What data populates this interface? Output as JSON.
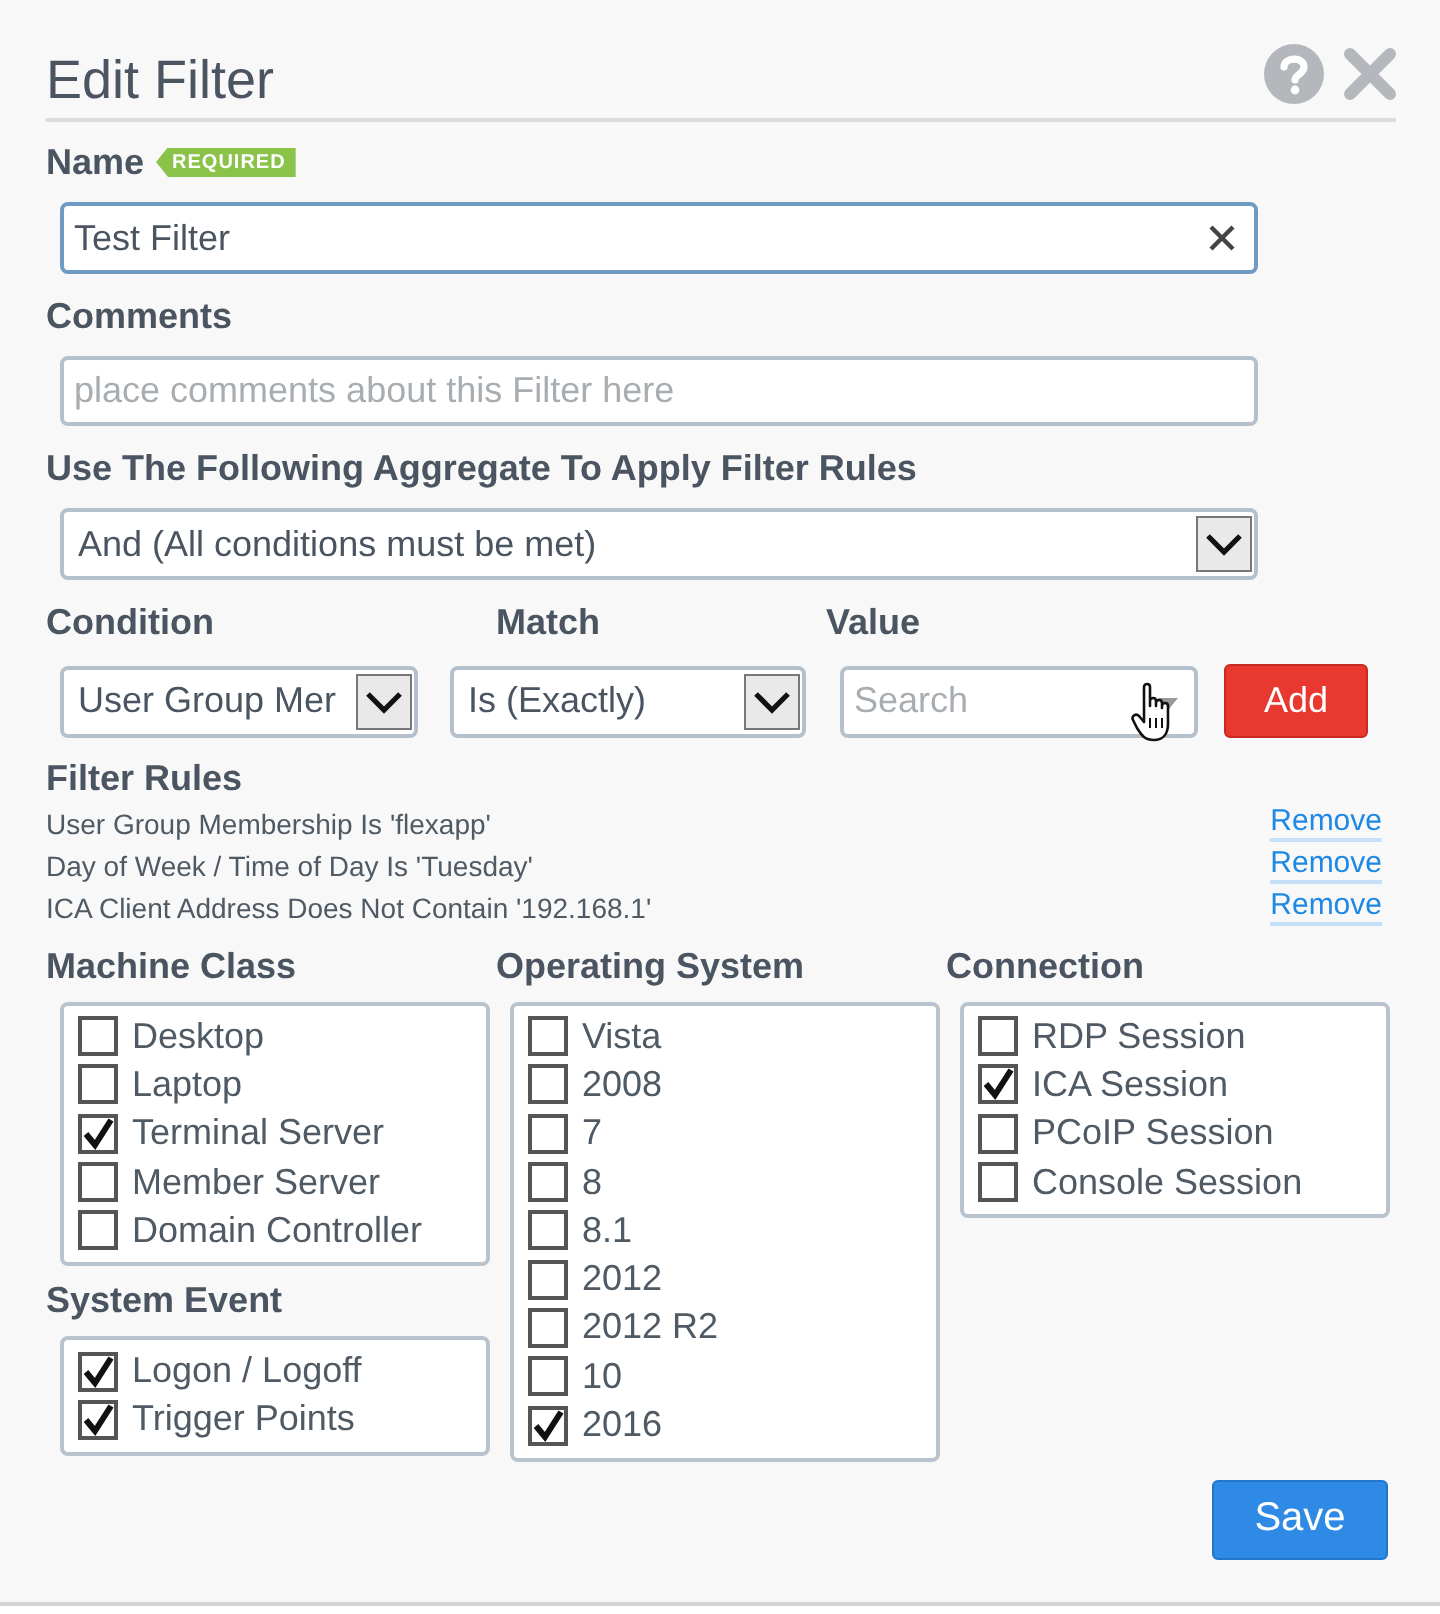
{
  "dialog": {
    "title": "Edit Filter"
  },
  "name": {
    "label": "Name",
    "badge": "REQUIRED",
    "value": "Test Filter"
  },
  "comments": {
    "label": "Comments",
    "placeholder": "place comments about this Filter here"
  },
  "aggregate": {
    "label": "Use The Following Aggregate To Apply Filter Rules",
    "value": "And (All conditions must be met)"
  },
  "condition_row": [
    {
      "label": "Condition",
      "kind": "select",
      "value": "User Group Mer"
    },
    {
      "label": "Match",
      "kind": "select",
      "value": "Is (Exactly)"
    },
    {
      "label": "Value",
      "kind": "search",
      "placeholder": "Search"
    }
  ],
  "add_button": "Add",
  "filter_rules": {
    "label": "Filter Rules",
    "rules": [
      {
        "text": "User Group Membership Is 'flexapp'",
        "action": "Remove"
      },
      {
        "text": "Day of Week / Time of Day Is 'Tuesday'",
        "action": "Remove"
      },
      {
        "text": "ICA Client Address Does Not Contain '192.168.1'",
        "action": "Remove"
      }
    ]
  },
  "columns": [
    {
      "groups": [
        {
          "label": "Machine Class",
          "options": [
            {
              "label": "Desktop",
              "checked": false
            },
            {
              "label": "Laptop",
              "checked": false
            },
            {
              "label": "Terminal Server",
              "checked": true
            },
            {
              "label": "Member Server",
              "checked": false
            },
            {
              "label": "Domain Controller",
              "checked": false
            }
          ]
        },
        {
          "label": "System Event",
          "options": [
            {
              "label": "Logon / Logoff",
              "checked": true
            },
            {
              "label": "Trigger Points",
              "checked": true
            }
          ]
        }
      ]
    },
    {
      "groups": [
        {
          "label": "Operating System",
          "options": [
            {
              "label": "Vista",
              "checked": false
            },
            {
              "label": "2008",
              "checked": false
            },
            {
              "label": "7",
              "checked": false
            },
            {
              "label": "8",
              "checked": false
            },
            {
              "label": "8.1",
              "checked": false
            },
            {
              "label": "2012",
              "checked": false
            },
            {
              "label": "2012 R2",
              "checked": false
            },
            {
              "label": "10",
              "checked": false
            },
            {
              "label": "2016",
              "checked": true
            }
          ]
        }
      ]
    },
    {
      "groups": [
        {
          "label": "Connection",
          "options": [
            {
              "label": "RDP Session",
              "checked": false
            },
            {
              "label": "ICA Session",
              "checked": true
            },
            {
              "label": "PCoIP Session",
              "checked": false
            },
            {
              "label": "Console Session",
              "checked": false
            }
          ]
        }
      ]
    }
  ],
  "save_button": "Save"
}
